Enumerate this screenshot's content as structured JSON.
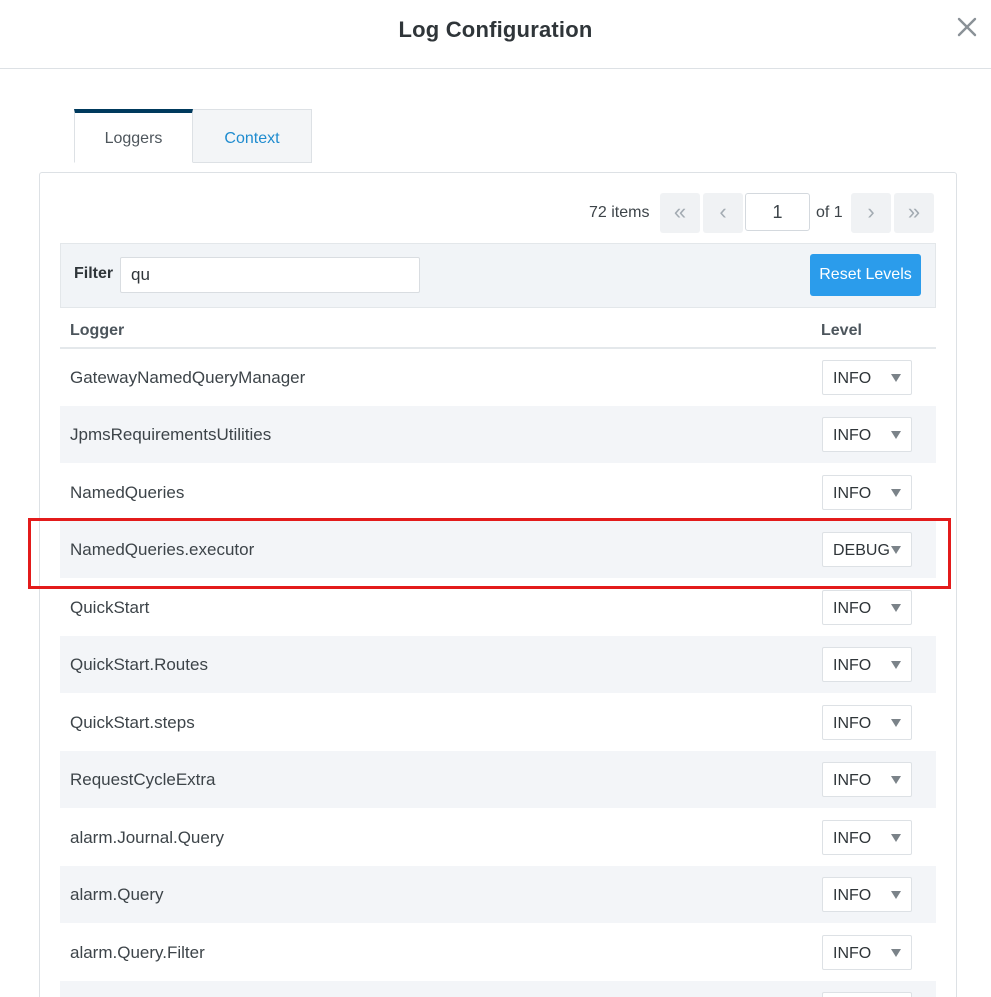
{
  "modal": {
    "title": "Log Configuration",
    "close_icon": "close-icon"
  },
  "tabs": [
    {
      "label": "Loggers",
      "active": true
    },
    {
      "label": "Context",
      "active": false
    }
  ],
  "pager": {
    "items_label": "72 items",
    "first_glyph": "«",
    "prev_glyph": "‹",
    "current_page": "1",
    "of_label": "of 1",
    "next_glyph": "›",
    "last_glyph": "»"
  },
  "filter": {
    "label": "Filter",
    "value": "qu",
    "reset_label": "Reset Levels"
  },
  "table": {
    "columns": [
      "Logger",
      "Level"
    ],
    "rows": [
      {
        "name": "GatewayNamedQueryManager",
        "level": "INFO"
      },
      {
        "name": "JpmsRequirementsUtilities",
        "level": "INFO"
      },
      {
        "name": "NamedQueries",
        "level": "INFO"
      },
      {
        "name": "NamedQueries.executor",
        "level": "DEBUG"
      },
      {
        "name": "QuickStart",
        "level": "INFO"
      },
      {
        "name": "QuickStart.Routes",
        "level": "INFO"
      },
      {
        "name": "QuickStart.steps",
        "level": "INFO"
      },
      {
        "name": "RequestCycleExtra",
        "level": "INFO"
      },
      {
        "name": "alarm.Journal.Query",
        "level": "INFO"
      },
      {
        "name": "alarm.Query",
        "level": "INFO"
      },
      {
        "name": "alarm.Query.Filter",
        "level": "INFO"
      },
      {
        "name": "",
        "level": ""
      }
    ]
  },
  "colors": {
    "highlight": "#e31b1b",
    "accent": "#2b9ceb",
    "tab_active_border": "#003a5d"
  }
}
